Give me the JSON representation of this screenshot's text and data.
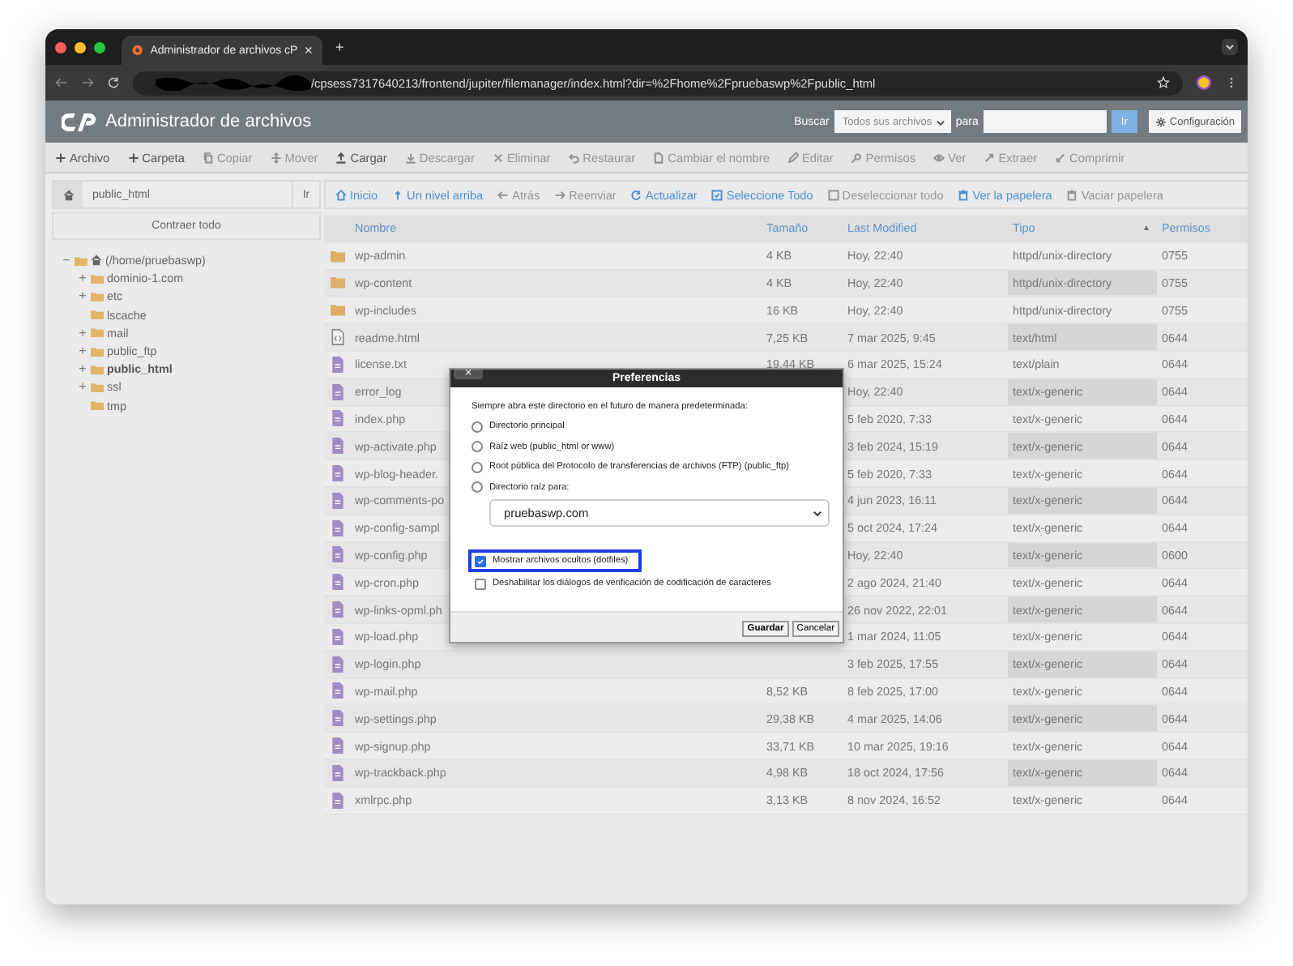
{
  "browser": {
    "tab_title": "Administrador de archivos cP",
    "tab_close": "×",
    "new_tab": "+",
    "url": "/cpsess7317640213/frontend/jupiter/filemanager/index.html?dir=%2Fhome%2Fpruebaswp%2Fpublic_html"
  },
  "header": {
    "title": "Administrador de archivos",
    "search_label": "Buscar",
    "search_scope": "Todos sus archivos",
    "for_label": "para",
    "go": "Ir",
    "settings": "Configuración"
  },
  "toolbar": [
    {
      "label": "Archivo",
      "disabled": false
    },
    {
      "label": "Carpeta",
      "disabled": false
    },
    {
      "label": "Copiar",
      "disabled": true
    },
    {
      "label": "Mover",
      "disabled": true
    },
    {
      "label": "Cargar",
      "disabled": false
    },
    {
      "label": "Descargar",
      "disabled": true
    },
    {
      "label": "Eliminar",
      "disabled": true
    },
    {
      "label": "Restaurar",
      "disabled": true
    },
    {
      "label": "Cambiar el nombre",
      "disabled": true
    },
    {
      "label": "Editar",
      "disabled": true
    },
    {
      "label": "Permisos",
      "disabled": true
    },
    {
      "label": "Ver",
      "disabled": true
    },
    {
      "label": "Extraer",
      "disabled": true
    },
    {
      "label": "Comprimir",
      "disabled": true
    }
  ],
  "sidebar": {
    "path": "public_html",
    "go": "Ir",
    "collapse": "Contraer todo",
    "tree": [
      {
        "label": "(/home/pruebaswp)",
        "toggle": "−",
        "selected": false,
        "children": [
          {
            "label": "dominio-1.com",
            "toggle": "+",
            "selected": false
          },
          {
            "label": "etc",
            "toggle": "+",
            "selected": false
          },
          {
            "label": "lscache",
            "selected": false
          },
          {
            "label": "mail",
            "toggle": "+",
            "selected": false
          },
          {
            "label": "public_ftp",
            "toggle": "+",
            "selected": false
          },
          {
            "label": "public_html",
            "toggle": "+",
            "selected": true
          },
          {
            "label": "ssl",
            "toggle": "+",
            "selected": false
          },
          {
            "label": "tmp",
            "selected": false
          }
        ]
      }
    ]
  },
  "nav": [
    {
      "label": "Inicio",
      "disabled": false
    },
    {
      "label": "Un nivel arriba",
      "disabled": false
    },
    {
      "label": "Atrás",
      "disabled": true
    },
    {
      "label": "Reenviar",
      "disabled": true
    },
    {
      "label": "Actualizar",
      "disabled": false
    },
    {
      "label": "Seleccione Todo",
      "disabled": false
    },
    {
      "label": "Deseleccionar todo",
      "disabled": true
    },
    {
      "label": "Ver la papelera",
      "disabled": false
    },
    {
      "label": "Vaciar papelera",
      "disabled": true
    }
  ],
  "table": {
    "columns": [
      "Nombre",
      "Tamaño",
      "Last Modified",
      "Tipo",
      "Permisos"
    ],
    "sort_mark": "▲",
    "rows": [
      {
        "kind": "folder",
        "name": "wp-admin",
        "size": "4 KB",
        "modified": "Hoy, 22:40",
        "type": "httpd/unix-directory",
        "perms": "0755"
      },
      {
        "kind": "folder",
        "name": "wp-content",
        "size": "4 KB",
        "modified": "Hoy, 22:40",
        "type": "httpd/unix-directory",
        "perms": "0755"
      },
      {
        "kind": "folder",
        "name": "wp-includes",
        "size": "16 KB",
        "modified": "Hoy, 22:40",
        "type": "httpd/unix-directory",
        "perms": "0755"
      },
      {
        "kind": "html",
        "name": "readme.html",
        "size": "7,25 KB",
        "modified": "7 mar 2025, 9:45",
        "type": "text/html",
        "perms": "0644"
      },
      {
        "kind": "file",
        "name": "license.txt",
        "size": "19,44 KB",
        "modified": "6 mar 2025, 15:24",
        "type": "text/plain",
        "perms": "0644"
      },
      {
        "kind": "file",
        "name": "error_log",
        "modified": "Hoy, 22:40",
        "type": "text/x-generic",
        "perms": "0644"
      },
      {
        "kind": "file",
        "name": "index.php",
        "modified": "5 feb 2020, 7:33",
        "type": "text/x-generic",
        "perms": "0644"
      },
      {
        "kind": "file",
        "name": "wp-activate.php",
        "modified": "3 feb 2024, 15:19",
        "type": "text/x-generic",
        "perms": "0644"
      },
      {
        "kind": "file",
        "name": "wp-blog-header.",
        "modified": "5 feb 2020, 7:33",
        "type": "text/x-generic",
        "perms": "0644"
      },
      {
        "kind": "file",
        "name": "wp-comments-po",
        "modified": "4 jun 2023, 16:11",
        "type": "text/x-generic",
        "perms": "0644"
      },
      {
        "kind": "file",
        "name": "wp-config-sampl",
        "modified": "5 oct 2024, 17:24",
        "type": "text/x-generic",
        "perms": "0644"
      },
      {
        "kind": "file",
        "name": "wp-config.php",
        "modified": "Hoy, 22:40",
        "type": "text/x-generic",
        "perms": "0600"
      },
      {
        "kind": "file",
        "name": "wp-cron.php",
        "modified": "2 ago 2024, 21:40",
        "type": "text/x-generic",
        "perms": "0644"
      },
      {
        "kind": "file",
        "name": "wp-links-opml.ph",
        "modified": "26 nov 2022, 22:01",
        "type": "text/x-generic",
        "perms": "0644"
      },
      {
        "kind": "file",
        "name": "wp-load.php",
        "modified": "1 mar 2024, 11:05",
        "type": "text/x-generic",
        "perms": "0644"
      },
      {
        "kind": "file",
        "name": "wp-login.php",
        "modified": "3 feb 2025, 17:55",
        "type": "text/x-generic",
        "perms": "0644"
      },
      {
        "kind": "file",
        "name": "wp-mail.php",
        "size": "8,52 KB",
        "modified": "8 feb 2025, 17:00",
        "type": "text/x-generic",
        "perms": "0644"
      },
      {
        "kind": "file",
        "name": "wp-settings.php",
        "size": "29,38 KB",
        "modified": "4 mar 2025, 14:06",
        "type": "text/x-generic",
        "perms": "0644"
      },
      {
        "kind": "file",
        "name": "wp-signup.php",
        "size": "33,71 KB",
        "modified": "10 mar 2025, 19:16",
        "type": "text/x-generic",
        "perms": "0644"
      },
      {
        "kind": "file",
        "name": "wp-trackback.php",
        "size": "4,98 KB",
        "modified": "18 oct 2024, 17:56",
        "type": "text/x-generic",
        "perms": "0644"
      },
      {
        "kind": "file",
        "name": "xmlrpc.php",
        "size": "3,13 KB",
        "modified": "8 nov 2024, 16:52",
        "type": "text/x-generic",
        "perms": "0644"
      }
    ]
  },
  "dialog": {
    "title": "Preferencias",
    "close": "×",
    "intro": "Siempre abra este directorio en el futuro de manera predeterminada:",
    "radios": [
      {
        "label": "Directorio principal",
        "selected": false
      },
      {
        "label": "Raíz web (public_html or www)",
        "selected": false
      },
      {
        "label": "Root pública del Protocolo de transferencias de archivos (FTP) (public_ftp)",
        "selected": false
      },
      {
        "label": "Directorio raíz para:",
        "selected": false
      }
    ],
    "domain": "pruebaswp.com",
    "checkboxes": [
      {
        "label": "Mostrar archivos ocultos (dotfiles)",
        "checked": true,
        "highlighted": true
      },
      {
        "label": "Deshabilitar los diálogos de verificación de codificación de caracteres",
        "checked": false,
        "highlighted": false
      }
    ],
    "buttons": [
      "Guardar",
      "Cancelar"
    ]
  }
}
